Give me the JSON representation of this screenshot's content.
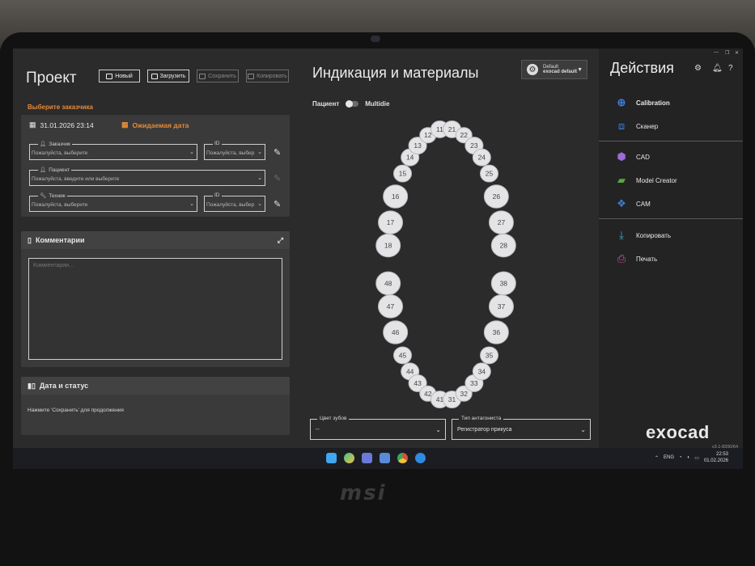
{
  "brand": "msi",
  "project": {
    "title": "Проект",
    "btn_new": "Новый",
    "btn_load": "Загрузить",
    "btn_save": "Сохранить",
    "btn_copy": "Копировать",
    "pick_client": "Выберите заказчика",
    "date": "31.01.2026 23:14",
    "expected_date": "Ожидаемая дата",
    "client_label": "Заказчик",
    "client_value": "Пожалуйста, выберите",
    "id_label": "ID",
    "id_value": "Пожалуйста, выбер",
    "patient_label": "Пациент",
    "patient_value": "Пожалуйста, введите или выберите",
    "tech_label": "Техник",
    "tech_value": "Пожалуйста, выберите",
    "id2_label": "ID",
    "id2_value": "Пожалуйста, выбер"
  },
  "comments": {
    "title": "Комментарии",
    "placeholder": "Комментарии..."
  },
  "status": {
    "title": "Дата и статус",
    "text": "Нажмите 'Сохранить' для продолжения"
  },
  "indication": {
    "title": "Индикация и материалы",
    "patient": "Пациент",
    "multidie": "Multidie",
    "profile_name": "Default",
    "profile_sub": "exocad default",
    "tooth_color_label": "Цвет зубов",
    "tooth_color_value": "--",
    "antagonist_label": "Тип антагониста",
    "antagonist_value": "Регистратор прикуса"
  },
  "teeth": {
    "upper": [
      "18",
      "17",
      "16",
      "15",
      "14",
      "13",
      "12",
      "11",
      "21",
      "22",
      "23",
      "24",
      "25",
      "26",
      "27",
      "28"
    ],
    "lower": [
      "48",
      "47",
      "46",
      "45",
      "44",
      "43",
      "42",
      "41",
      "31",
      "32",
      "33",
      "34",
      "35",
      "36",
      "37",
      "38"
    ]
  },
  "actions": {
    "title": "Действия",
    "items": [
      "Calibration",
      "Сканер",
      "CAD",
      "Model Creator",
      "CAM",
      "Копировать",
      "Печать"
    ],
    "logo": "exocad",
    "version": "v3.1-8200/64"
  },
  "taskbar": {
    "lang": "ENG",
    "time": "22:53",
    "date": "01.02.2026"
  },
  "colors": {
    "accent_orange": "#e58a3a",
    "calibration_blue": "#3b7dd8",
    "cad_purple": "#9b6bd6",
    "model_green": "#5aa83a",
    "print_magenta": "#d24fb0"
  }
}
